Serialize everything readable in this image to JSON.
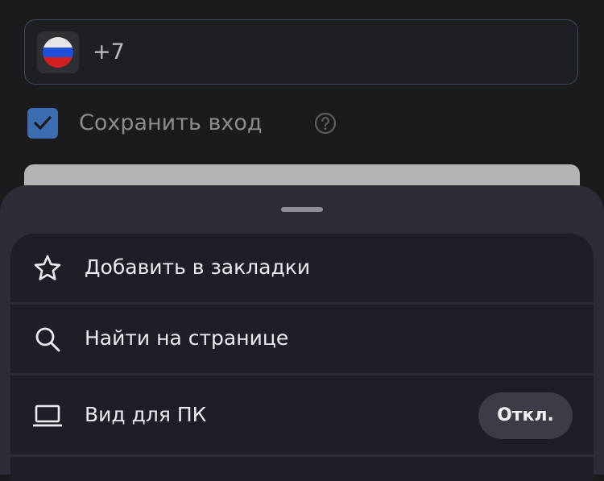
{
  "login_form": {
    "phone_prefix": "+7",
    "country_flag": "russia-flag-icon",
    "remember_label": "Сохранить вход",
    "remember_checked": true
  },
  "bottom_sheet": {
    "items": [
      {
        "icon": "star-icon",
        "label": "Добавить в закладки"
      },
      {
        "icon": "search-icon",
        "label": "Найти на странице"
      },
      {
        "icon": "laptop-icon",
        "label": "Вид для ПК",
        "toggle_label": "Откл."
      }
    ]
  },
  "colors": {
    "background": "#1b1b1d",
    "sheet": "#2c2b36",
    "menu_item": "#1f1e26",
    "checkbox_accent": "#3d6cb1",
    "field_border": "#3b4a63"
  }
}
